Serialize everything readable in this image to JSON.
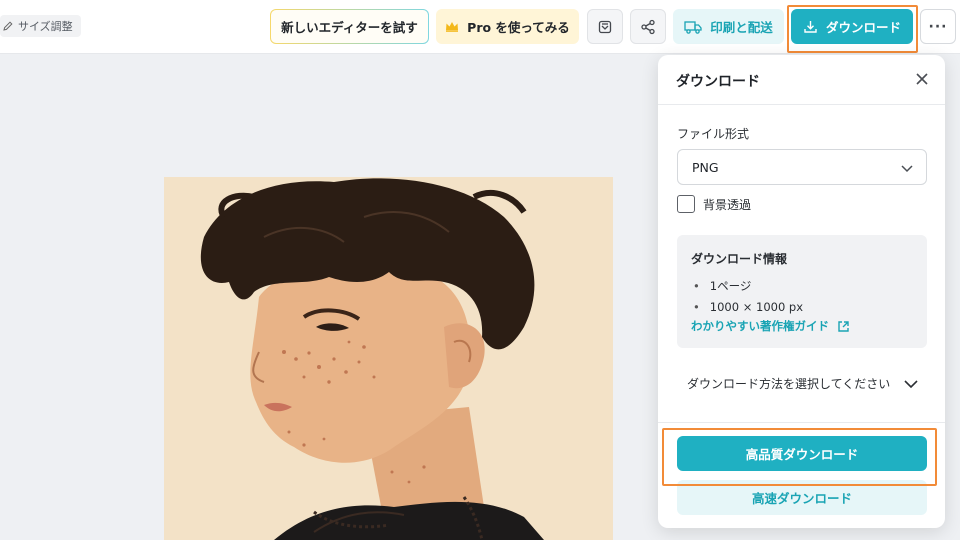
{
  "topbar": {
    "resize_label": "サイズ調整",
    "try_editor_label": "新しいエディターを試す",
    "pro_label": "Pro を使ってみる",
    "print_label": "印刷と配送",
    "download_label": "ダウンロード",
    "more_label": "···"
  },
  "panel": {
    "title": "ダウンロード",
    "format_label": "ファイル形式",
    "format_value": "PNG",
    "transparent_bg_label": "背景透過",
    "info": {
      "title": "ダウンロード情報",
      "items": [
        "1ページ",
        "1000 × 1000 px"
      ],
      "guide_link": "わかりやすい著作権ガイド"
    },
    "method_label": "ダウンロード方法を選択してください",
    "hq_download_label": "高品質ダウンロード",
    "fast_download_label": "高速ダウンロード"
  },
  "colors": {
    "accent": "#1fb0c2",
    "accent_light": "#e6f6f8",
    "pro_bg": "#fff5d7",
    "highlight": "#f28b38"
  },
  "icons": [
    "pencil-icon",
    "crown-icon",
    "save-icon",
    "share-icon",
    "truck-icon",
    "download-icon",
    "close-icon",
    "chevron-down-icon",
    "external-link-icon"
  ]
}
